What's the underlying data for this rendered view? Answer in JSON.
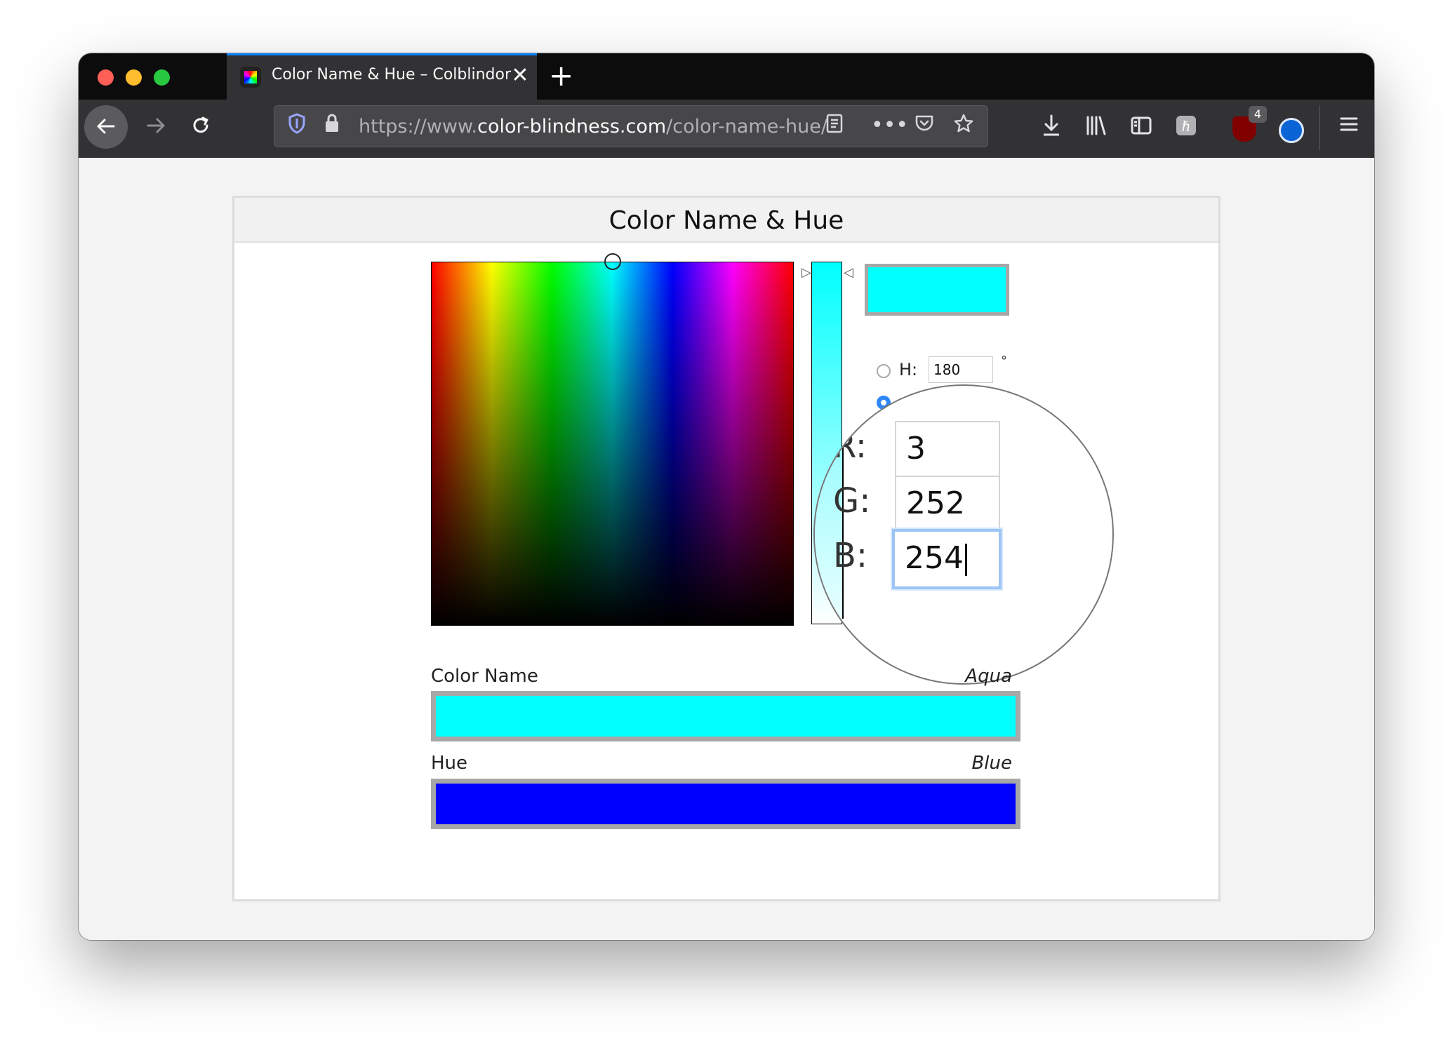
{
  "browser": {
    "tab_title": "Color Name & Hue – Colblindor",
    "tab_close": "✕",
    "new_tab": "+",
    "url_prefix": "https://www.",
    "url_domain": "color-blindness.com",
    "url_path": "/color-name-hue/",
    "extension_badge": "4"
  },
  "page": {
    "title": "Color Name & Hue",
    "h_label": "H:",
    "h_value": "180",
    "degree_symbol": "°",
    "r_label": "R:",
    "r_value": "3",
    "g_label": "G:",
    "g_value": "252",
    "b_label": "B:",
    "b_value": "254",
    "color_name_label": "Color Name",
    "color_name_value": "Aqua",
    "hue_label": "Hue",
    "hue_value": "Blue"
  },
  "colors": {
    "selected": "#00ffff",
    "color_name_swatch": "#00ffff",
    "hue_swatch": "#0000ff",
    "accent": "#0a84ff"
  },
  "icons": {
    "back": "arrow-left-icon",
    "forward": "arrow-right-icon",
    "reload": "reload-icon",
    "tracking": "shield-icon",
    "lock": "lock-icon",
    "reader": "reader-view-icon",
    "more": "more-icon",
    "pocket": "pocket-icon",
    "bookmark": "star-icon",
    "download": "download-icon",
    "library": "library-icon",
    "sidebar": "sidebar-icon",
    "menu": "hamburger-menu-icon"
  }
}
